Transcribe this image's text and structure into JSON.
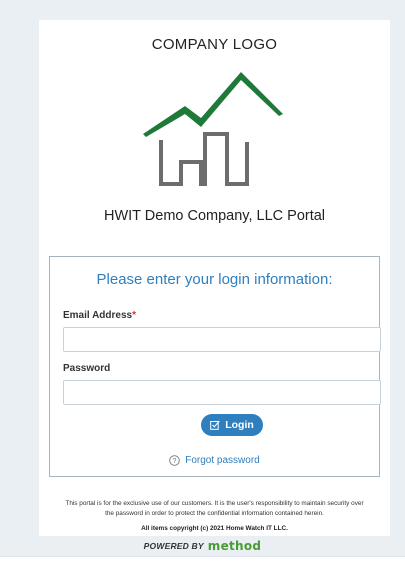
{
  "logo": {
    "title": "COMPANY LOGO",
    "icon": "house-with-chart-icon",
    "colors": {
      "roof": "#1f7a3a",
      "walls": "#6d6d6d"
    }
  },
  "portal_title": "HWIT Demo Company, LLC Portal",
  "login": {
    "heading": "Please enter your login information:",
    "email_label": "Email Address",
    "required_marker": "*",
    "email_value": "",
    "password_label": "Password",
    "password_value": "",
    "button_label": "Login",
    "button_icon": "checkbox-icon",
    "forgot_label": "Forgot password",
    "forgot_icon": "help-circle-icon"
  },
  "footer": {
    "notice_line1": "This portal is for the exclusive use of our customers. It is the user's responsibility to maintain security over",
    "notice_line2": "the password in order to protect the confidential information contained herein.",
    "copyright": "All items copyright (c) 2021 Home Watch IT LLC."
  },
  "powered_by": {
    "prefix": "POWERED BY",
    "brand": "method"
  },
  "colors": {
    "accent": "#2f7fbf",
    "required": "#d9322b",
    "brand_green": "#4a9a35",
    "page_background": "#e9eff3"
  }
}
